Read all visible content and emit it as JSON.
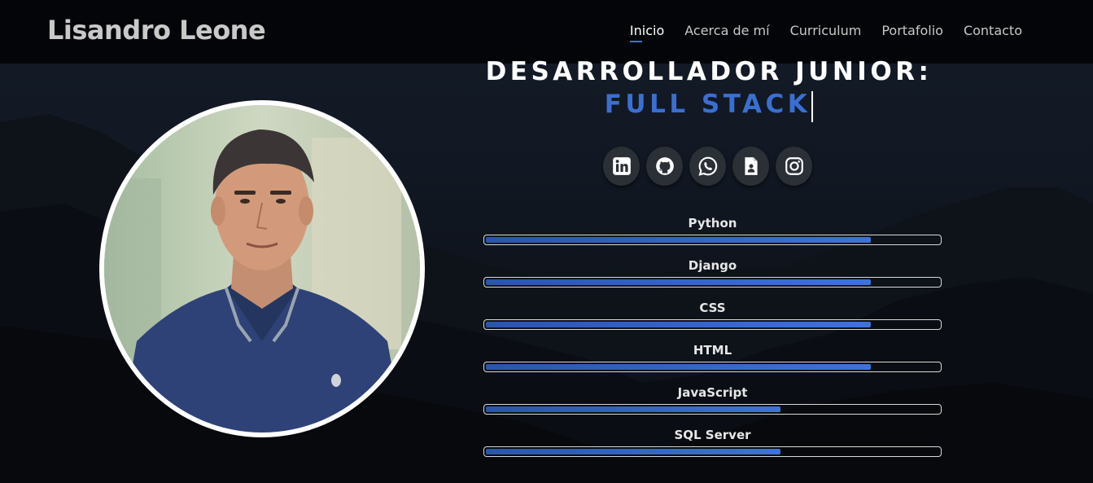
{
  "header": {
    "brand": "Lisandro Leone",
    "nav": [
      {
        "label": "Inicio",
        "active": true
      },
      {
        "label": "Acerca de mí",
        "active": false
      },
      {
        "label": "Curriculum",
        "active": false
      },
      {
        "label": "Portafolio",
        "active": false
      },
      {
        "label": "Contacto",
        "active": false
      }
    ]
  },
  "hero": {
    "title_line1": "DESARROLLADOR JUNIOR:",
    "title_line2": "FULL STACK"
  },
  "social": [
    {
      "icon": "linkedin-icon"
    },
    {
      "icon": "github-icon"
    },
    {
      "icon": "whatsapp-icon"
    },
    {
      "icon": "cv-document-icon"
    },
    {
      "icon": "instagram-icon"
    }
  ],
  "skills": [
    {
      "name": "Python",
      "level": 0.85
    },
    {
      "name": "Django",
      "level": 0.85
    },
    {
      "name": "CSS",
      "level": 0.85
    },
    {
      "name": "HTML",
      "level": 0.85
    },
    {
      "name": "JavaScript",
      "level": 0.65
    },
    {
      "name": "SQL Server",
      "level": 0.65
    }
  ],
  "colors": {
    "accent": "#3a6fd2",
    "header_bg": "#050608",
    "page_bg": "#10141c"
  }
}
